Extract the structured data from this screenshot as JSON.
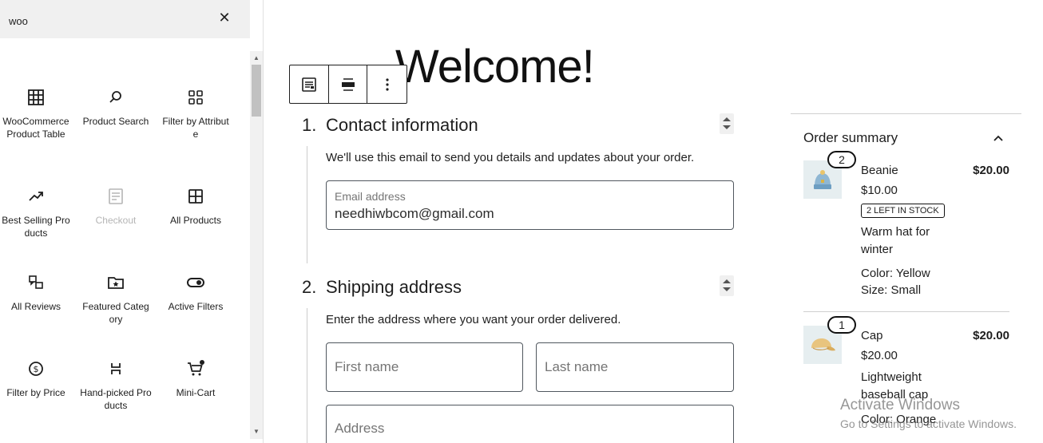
{
  "inserter": {
    "search_value": "woo",
    "clear_icon": "close-icon",
    "blocks": [
      {
        "label": "WooCommerce Product Table",
        "icon": "table-icon",
        "disabled": false
      },
      {
        "label": "Product Search",
        "icon": "search-icon",
        "disabled": false
      },
      {
        "label": "Filter by Attribute",
        "icon": "grid-icon",
        "disabled": false
      },
      {
        "label": "Best Selling Products",
        "icon": "trending-icon",
        "disabled": false
      },
      {
        "label": "Checkout",
        "icon": "checkout-icon",
        "disabled": true
      },
      {
        "label": "All Products",
        "icon": "all-products-icon",
        "disabled": false
      },
      {
        "label": "All Reviews",
        "icon": "reviews-icon",
        "disabled": false
      },
      {
        "label": "Featured Category",
        "icon": "folder-star-icon",
        "disabled": false
      },
      {
        "label": "Active Filters",
        "icon": "toggle-icon",
        "disabled": false
      },
      {
        "label": "Filter by Price",
        "icon": "dollar-icon",
        "disabled": false
      },
      {
        "label": "Hand-picked Products",
        "icon": "hand-picked-icon",
        "disabled": false
      },
      {
        "label": "Mini-Cart",
        "icon": "cart-icon",
        "disabled": false
      }
    ]
  },
  "editor": {
    "heading": "Welcome!",
    "toolbar": {
      "block_type_icon": "checkout-block-icon",
      "align_icon": "align-center-icon",
      "options_icon": "more-vertical-icon"
    },
    "contact": {
      "number": "1.",
      "title": "Contact information",
      "description": "We'll use this email to send you details and updates about your order.",
      "email_label": "Email address",
      "email_value": "needhiwbcom@gmail.com"
    },
    "shipping": {
      "number": "2.",
      "title": "Shipping address",
      "description": "Enter the address where you want your order delivered.",
      "first_name_placeholder": "First name",
      "last_name_placeholder": "Last name",
      "address_placeholder": "Address"
    }
  },
  "order_summary": {
    "title": "Order summary",
    "toggle_icon": "chevron-up-icon",
    "items": [
      {
        "quantity": "2",
        "name": "Beanie",
        "price": "$10.00",
        "total": "$20.00",
        "stock_badge": "2 LEFT IN STOCK",
        "description": "Warm hat for winter",
        "attributes": [
          "Color: Yellow",
          "Size: Small"
        ],
        "image": "beanie-image"
      },
      {
        "quantity": "1",
        "name": "Cap",
        "price": "$20.00",
        "total": "$20.00",
        "description": "Lightweight baseball cap",
        "attributes": [
          "Color: Orange"
        ],
        "image": "cap-image"
      }
    ]
  },
  "watermark": {
    "title": "Activate Windows",
    "subtitle": "Go to Settings to activate Windows."
  }
}
